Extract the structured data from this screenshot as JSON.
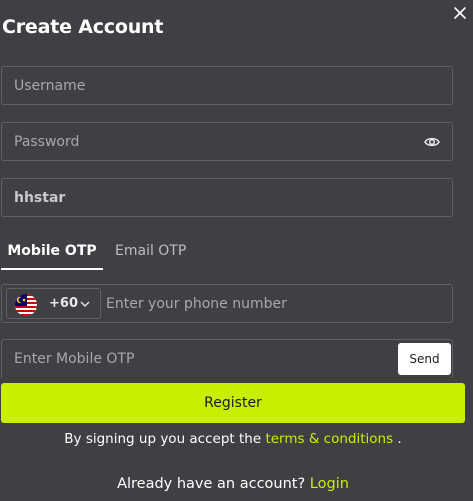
{
  "dialog": {
    "title": "Create Account",
    "close_icon": "close-icon"
  },
  "form": {
    "username": {
      "placeholder": "Username",
      "value": ""
    },
    "password": {
      "placeholder": "Password",
      "value": "",
      "toggle_icon": "eye-icon"
    },
    "referral": {
      "value": "hhstar"
    }
  },
  "tabs": [
    {
      "label": "Mobile OTP",
      "active": true
    },
    {
      "label": "Email OTP",
      "active": false
    }
  ],
  "phone": {
    "country_flag": "malaysia-flag-icon",
    "dial_code": "+60",
    "placeholder": "Enter your phone number"
  },
  "otp": {
    "placeholder": "Enter Mobile OTP",
    "send_label": "Send"
  },
  "register_label": "Register",
  "terms": {
    "prefix": "By signing up you accept the",
    "link": "terms & conditions",
    "suffix": "."
  },
  "signin": {
    "prefix": "Already have an account?",
    "link": "Login"
  },
  "colors": {
    "background": "#3f4043",
    "accent": "#c9ef00",
    "border": "#5f6064"
  }
}
